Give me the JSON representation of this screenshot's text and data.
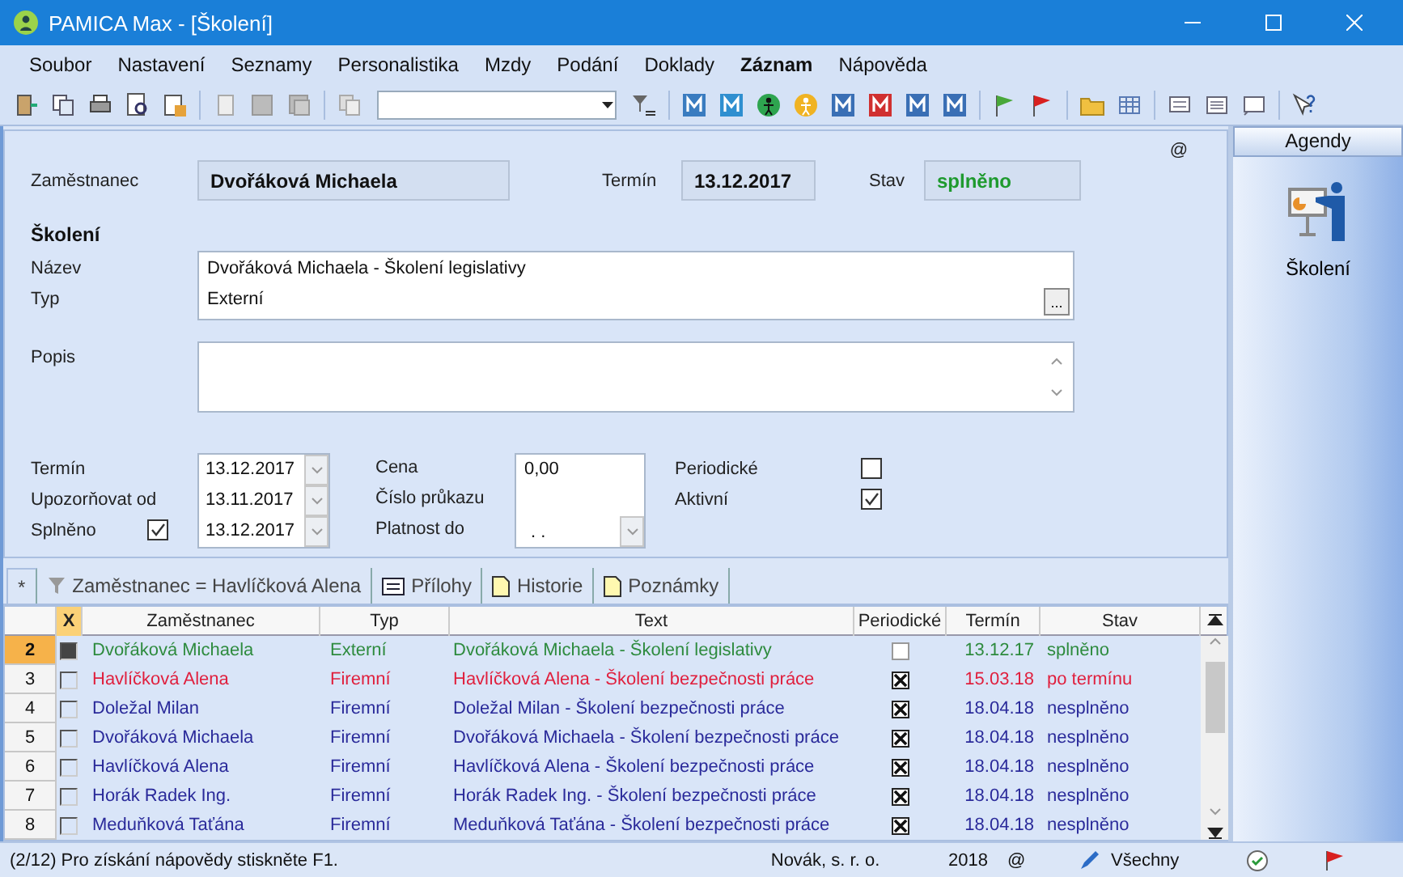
{
  "window": {
    "title": "PAMICA Max - [Školení]"
  },
  "menu": [
    {
      "label": "Soubor",
      "active": false
    },
    {
      "label": "Nastavení",
      "active": false
    },
    {
      "label": "Seznamy",
      "active": false
    },
    {
      "label": "Personalistika",
      "active": false
    },
    {
      "label": "Mzdy",
      "active": false
    },
    {
      "label": "Podání",
      "active": false
    },
    {
      "label": "Doklady",
      "active": false
    },
    {
      "label": "Záznam",
      "active": true
    },
    {
      "label": "Nápověda",
      "active": false
    }
  ],
  "header": {
    "employee_label": "Zaměstnanec",
    "employee": "Dvořáková Michaela",
    "term_label": "Termín",
    "term": "13.12.2017",
    "state_label": "Stav",
    "state": "splněno",
    "at": "@"
  },
  "training": {
    "section": "Školení",
    "name_label": "Název",
    "type_label": "Typ",
    "name": "Dvořáková Michaela - Školení legislativy",
    "type": "Externí",
    "more": "...",
    "description_label": "Popis",
    "dates": [
      {
        "label": "Termín",
        "value": "13.12.2017",
        "kind": "plain"
      },
      {
        "label": "Upozorňovat od",
        "value": "13.11.2017",
        "kind": "plain"
      },
      {
        "label": "Splněno",
        "value": "13.12.2017",
        "kind": "check",
        "checked": true
      }
    ],
    "price_label": "Cena",
    "price": "0,00",
    "card_label": "Číslo průkazu",
    "valid_label": "Platnost do",
    "valid": ". .",
    "flags": [
      {
        "label": "Periodické",
        "checked": false
      },
      {
        "label": "Aktivní",
        "checked": true
      }
    ]
  },
  "tabs": [
    {
      "label": "*",
      "selected": true,
      "kind": "star"
    },
    {
      "label": "Zaměstnanec = Havlíčková Alena",
      "selected": false,
      "kind": "filter"
    },
    {
      "label": "Přílohy",
      "selected": false,
      "kind": "list"
    },
    {
      "label": "Historie",
      "selected": false,
      "kind": "doc"
    },
    {
      "label": "Poznámky",
      "selected": false,
      "kind": "doc"
    }
  ],
  "table": {
    "columns": [
      "X",
      "Zaměstnanec",
      "Typ",
      "Text",
      "Periodické",
      "Termín",
      "Stav"
    ],
    "rows": [
      {
        "number": "2",
        "selected": true,
        "checked": true,
        "color": "#2e8b3e",
        "employee": "Dvořáková Michaela",
        "type": "Externí",
        "text": "Dvořáková Michaela - Školení legislativy",
        "periodic": false,
        "term": "13.12.17",
        "state": "splněno"
      },
      {
        "number": "3",
        "selected": false,
        "checked": false,
        "color": "#e01f3d",
        "employee": "Havlíčková Alena",
        "type": "Firemní",
        "text": "Havlíčková Alena - Školení bezpečnosti práce",
        "periodic": true,
        "term": "15.03.18",
        "state": "po termínu"
      },
      {
        "number": "4",
        "selected": false,
        "checked": false,
        "color": "#2a2a9a",
        "employee": "Doležal Milan",
        "type": "Firemní",
        "text": "Doležal Milan - Školení bezpečnosti práce",
        "periodic": true,
        "term": "18.04.18",
        "state": "nesplněno"
      },
      {
        "number": "5",
        "selected": false,
        "checked": false,
        "color": "#2a2a9a",
        "employee": "Dvořáková Michaela",
        "type": "Firemní",
        "text": "Dvořáková Michaela - Školení bezpečnosti práce",
        "periodic": true,
        "term": "18.04.18",
        "state": "nesplněno"
      },
      {
        "number": "6",
        "selected": false,
        "checked": false,
        "color": "#2a2a9a",
        "employee": "Havlíčková Alena",
        "type": "Firemní",
        "text": "Havlíčková Alena - Školení bezpečnosti práce",
        "periodic": true,
        "term": "18.04.18",
        "state": "nesplněno"
      },
      {
        "number": "7",
        "selected": false,
        "checked": false,
        "color": "#2a2a9a",
        "employee": "Horák Radek Ing.",
        "type": "Firemní",
        "text": "Horák Radek Ing. - Školení bezpečnosti práce",
        "periodic": true,
        "term": "18.04.18",
        "state": "nesplněno"
      },
      {
        "number": "8",
        "selected": false,
        "checked": false,
        "color": "#2a2a9a",
        "employee": "Meduňková Taťána",
        "type": "Firemní",
        "text": "Meduňková Taťána - Školení bezpečnosti práce",
        "periodic": true,
        "term": "18.04.18",
        "state": "nesplněno"
      }
    ]
  },
  "agendas": {
    "title": "Agendy",
    "items": [
      {
        "label": "Školení",
        "selected": true
      }
    ]
  },
  "status_bar": {
    "message": "(2/12) Pro získání nápovědy stiskněte F1.",
    "company": "Novák, s. r. o.",
    "year": "2018",
    "at": "@",
    "filter": "Všechny"
  }
}
